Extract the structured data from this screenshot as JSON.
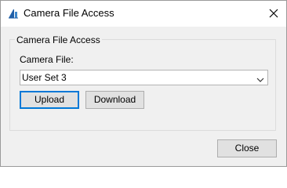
{
  "window": {
    "title": "Camera File Access",
    "icon": "camera-app-icon",
    "close_icon": "close-icon"
  },
  "group": {
    "legend": "Camera File Access",
    "field_label": "Camera File:",
    "select_value": "User Set 3",
    "select_icon": "chevron-down-icon"
  },
  "buttons": {
    "upload_label": "Upload",
    "download_label": "Download",
    "close_label": "Close"
  },
  "colors": {
    "focus_border": "#0078d7",
    "dialog_background": "#f0f0f0",
    "button_background": "#e1e1e1"
  }
}
